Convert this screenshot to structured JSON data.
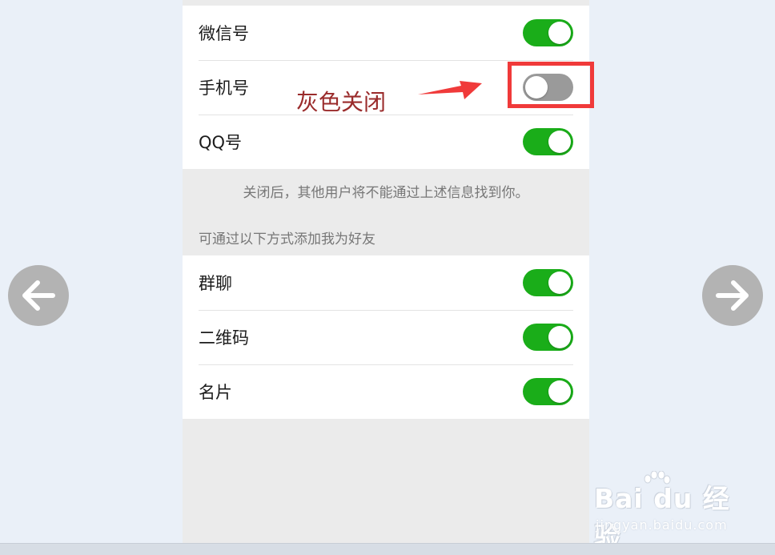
{
  "privacy": {
    "group1": [
      {
        "label": "微信号",
        "on": true
      },
      {
        "label": "手机号",
        "on": false
      },
      {
        "label": "QQ号",
        "on": true
      }
    ],
    "hint": "关闭后，其他用户将不能通过上述信息找到你。",
    "section_header": "可通过以下方式添加我为好友",
    "group2": [
      {
        "label": "群聊",
        "on": true
      },
      {
        "label": "二维码",
        "on": true
      },
      {
        "label": "名片",
        "on": true
      }
    ]
  },
  "annotation": {
    "text": "灰色关闭",
    "box_color": "#f03a3a",
    "text_color": "#9a2b2b"
  },
  "navigation": {
    "prev_icon": "arrow-left-icon",
    "next_icon": "arrow-right-icon"
  },
  "watermark": {
    "logo": "Bai du 经验",
    "url": "jingyan.baidu.com"
  },
  "colors": {
    "toggle_on": "#1aad19",
    "toggle_off": "#9a9a9a",
    "page_bg": "#eaf0f8"
  }
}
